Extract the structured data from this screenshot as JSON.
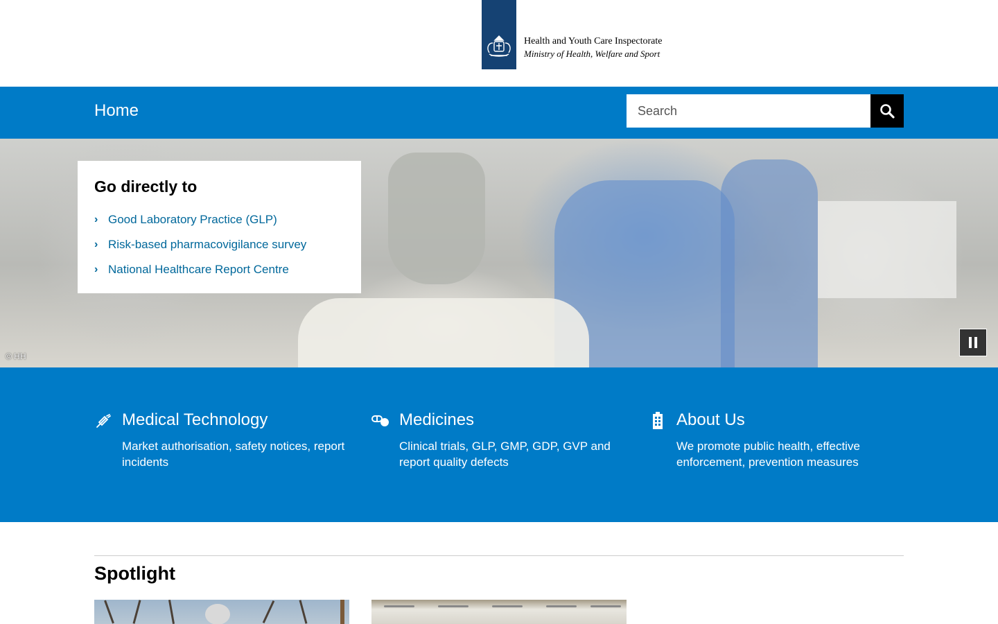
{
  "header": {
    "org_name": "Health and Youth Care Inspectorate",
    "org_sub": "Ministry of Health, Welfare and Sport",
    "logo_color": "#154273"
  },
  "nav": {
    "home_label": "Home",
    "search_placeholder": "Search",
    "search_button_icon": "search-icon",
    "bar_color": "#007bc7"
  },
  "hero": {
    "caption_title": "Go directly to",
    "links": [
      {
        "label": "Good Laboratory Practice (GLP)"
      },
      {
        "label": "Risk-based pharmacovigilance survey"
      },
      {
        "label": "National Healthcare Report Centre"
      }
    ],
    "photo_credit": "© HH",
    "pause_icon": "pause-icon",
    "link_color": "#01689b"
  },
  "topics": [
    {
      "title": "Medical Technology",
      "description": "Market authorisation, safety notices, report incidents",
      "icon": "syringe-icon"
    },
    {
      "title": "Medicines",
      "description": "Clinical trials, GLP, GMP, GDP, GVP and report quality defects",
      "icon": "pills-icon"
    },
    {
      "title": "About Us",
      "description": "We promote public health, effective enforcement, prevention measures",
      "icon": "building-icon"
    }
  ],
  "spotlight": {
    "title": "Spotlight"
  }
}
